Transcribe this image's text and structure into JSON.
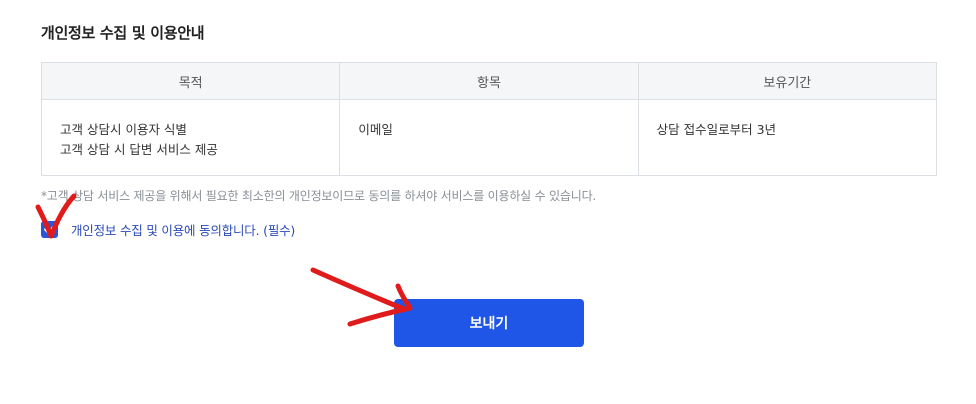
{
  "section": {
    "title": "개인정보 수집 및 이용안내"
  },
  "table": {
    "headers": [
      "목적",
      "항목",
      "보유기간"
    ],
    "row": {
      "purpose_lines": [
        "고객 상담시 이용자 식별",
        "고객 상담 시 답변 서비스 제공"
      ],
      "items": "이메일",
      "retention": "상담 접수일로부터 3년"
    }
  },
  "notice": "*고객 상담 서비스 제공을 위해서 필요한 최소한의 개인정보이므로 동의를 하셔야 서비스를 이용하실 수 있습니다.",
  "consent": {
    "label": "개인정보 수집 및 이용에 동의합니다. (필수)",
    "checked": true
  },
  "send_button": {
    "label": "보내기"
  },
  "colors": {
    "accent": "#1f56e8",
    "annotation": "#e01b1b"
  }
}
